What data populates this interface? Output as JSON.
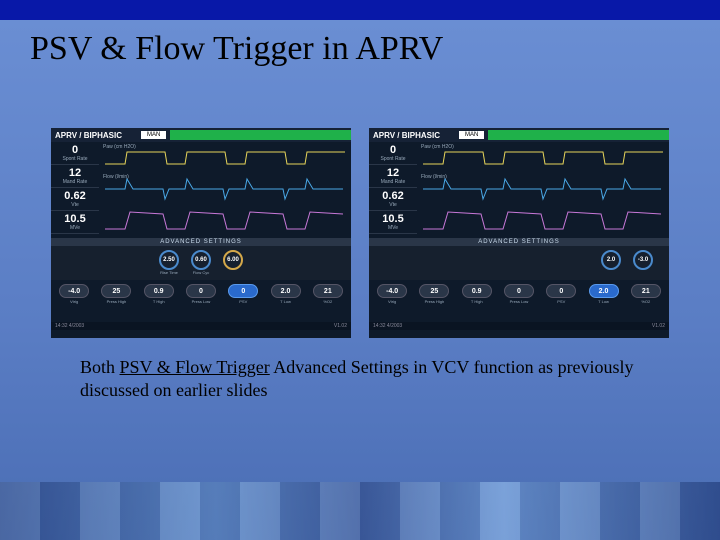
{
  "title": "PSV & Flow Trigger in APRV",
  "caption_parts": {
    "p1": "Both ",
    "p2": "PSV & Flow Trigger",
    "p3": " Advanced Settings in VCV function as previously discussed on earlier slides"
  },
  "ventilator": {
    "mode": "APRV / BIPHASIC",
    "man": "MAN",
    "advanced_label": "ADVANCED SETTINGS",
    "sidebar": [
      {
        "value": "0",
        "label": "Spont Rate"
      },
      {
        "value": "12",
        "label": "Mand Rate"
      },
      {
        "value": "0.62",
        "label": "Vte"
      },
      {
        "value": "10.5",
        "label": "MVe"
      }
    ],
    "waves": [
      {
        "label": "Paw (cm H2O)"
      },
      {
        "label": "Flow (l/min)"
      },
      {
        "label": ""
      }
    ],
    "top_dials": [
      {
        "value": "2.50",
        "label": "Rise Time"
      },
      {
        "value": "0.60",
        "label": "Flow Cyc"
      },
      {
        "value": "6.00",
        "label": ""
      }
    ],
    "left": {
      "bottom_dials": [
        {
          "value": "-4.0",
          "label": "Vtrig"
        },
        {
          "value": "25",
          "label": "Press High"
        },
        {
          "value": "0.9",
          "label": "T High"
        },
        {
          "value": "0",
          "label": "Press Low"
        },
        {
          "value": "0",
          "label": "PSV",
          "active": true
        },
        {
          "value": "2.0",
          "label": "T Low"
        },
        {
          "value": "21",
          "label": "%O2"
        }
      ],
      "status": {
        "left": "14:32  4/2003",
        "right": "V1.02"
      }
    },
    "right": {
      "top_dials_override": [
        {
          "value": "2.0",
          "label": ""
        },
        {
          "value": "-3.0",
          "label": ""
        }
      ],
      "bottom_dials": [
        {
          "value": "-4.0",
          "label": "Vtrig"
        },
        {
          "value": "25",
          "label": "Press High"
        },
        {
          "value": "0.9",
          "label": "T High"
        },
        {
          "value": "0",
          "label": "Press Low"
        },
        {
          "value": "0",
          "label": "PSV"
        },
        {
          "value": "2.0",
          "label": "T Low",
          "active": true
        },
        {
          "value": "21",
          "label": "%O2"
        }
      ],
      "status": {
        "left": "14:32  4/2003",
        "right": "V1.02"
      }
    }
  }
}
